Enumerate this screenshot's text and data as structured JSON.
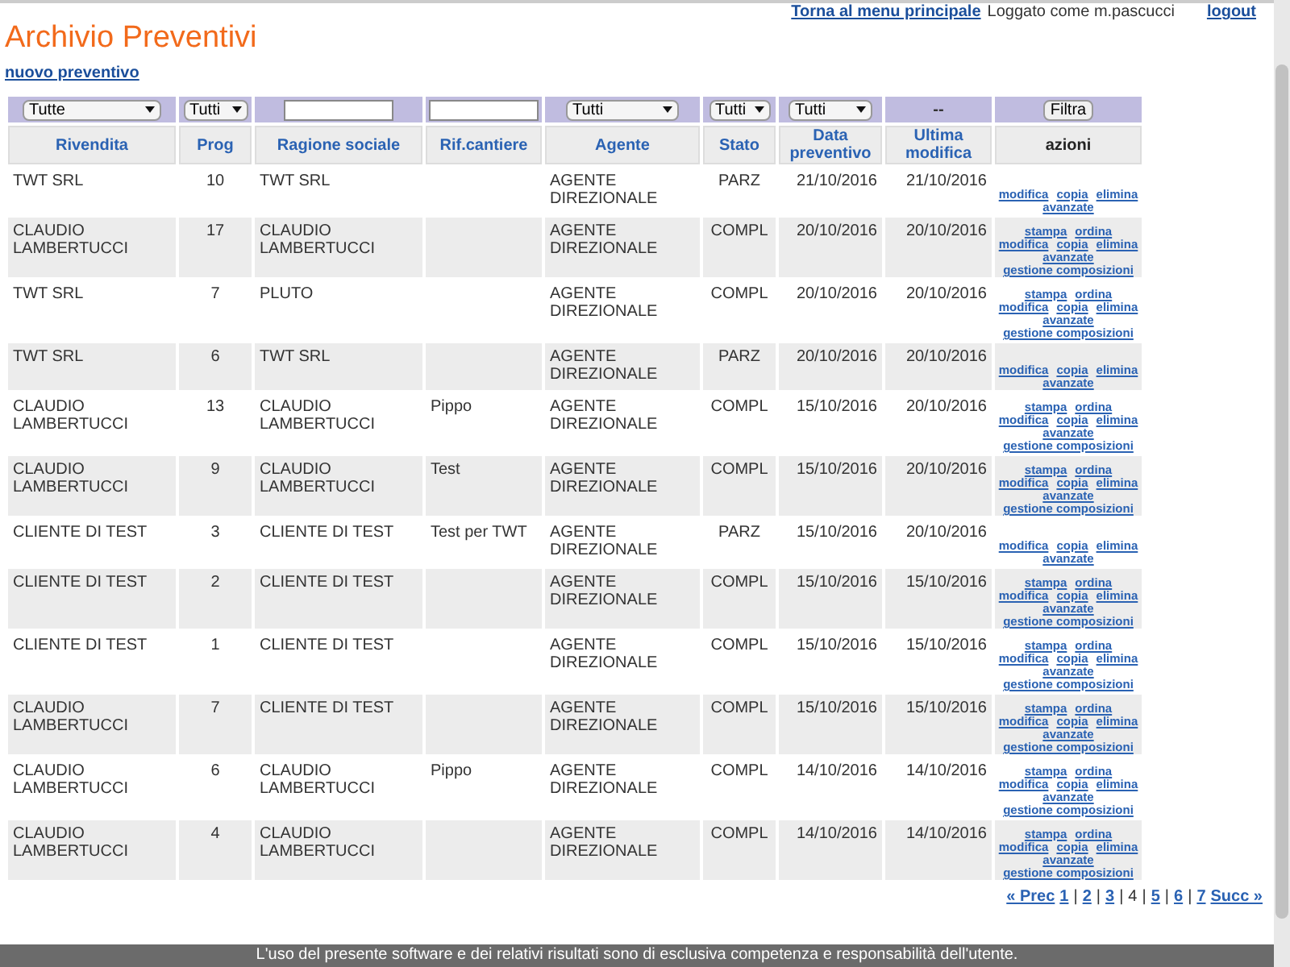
{
  "top_bar": {
    "menu_link": "Torna al menu principale",
    "user_text": "Loggato come m.pascucci",
    "logout_link": "logout"
  },
  "title": "Archivio Preventivi",
  "new_link": "nuovo preventivo",
  "filters": [
    {
      "kind": "select",
      "value": "Tutte"
    },
    {
      "kind": "select",
      "value": "Tutti"
    },
    {
      "kind": "input"
    },
    {
      "kind": "input"
    },
    {
      "kind": "select",
      "value": "Tutti"
    },
    {
      "kind": "select",
      "value": "Tutti"
    },
    {
      "kind": "select",
      "value": "Tutti"
    },
    {
      "kind": "text",
      "value": "--"
    },
    {
      "kind": "button",
      "value": "Filtra"
    }
  ],
  "table": {
    "columns": [
      "Rivendita",
      "Prog",
      "Ragione sociale",
      "Rif.cantiere",
      "Agente",
      "Stato",
      "Data preventivo",
      "Ultima modifica",
      "azioni"
    ],
    "rows": [
      {
        "cells": [
          "TWT SRL",
          "10",
          "TWT SRL",
          "",
          "AGENTE DIREZIONALE",
          "PARZ",
          "21/10/2016",
          "21/10/2016"
        ],
        "actions": [
          [
            "modifica",
            "copia",
            "elimina"
          ],
          [
            "avanzate"
          ]
        ]
      },
      {
        "cells": [
          "CLAUDIO LAMBERTUCCI",
          "17",
          "CLAUDIO LAMBERTUCCI",
          "",
          "AGENTE DIREZIONALE",
          "COMPL",
          "20/10/2016",
          "20/10/2016"
        ],
        "actions": [
          [
            "stampa",
            "ordina"
          ],
          [
            "modifica",
            "copia",
            "elimina"
          ],
          [
            "avanzate"
          ],
          [
            "gestione composizioni"
          ]
        ]
      },
      {
        "cells": [
          "TWT SRL",
          "7",
          "PLUTO",
          "",
          "AGENTE DIREZIONALE",
          "COMPL",
          "20/10/2016",
          "20/10/2016"
        ],
        "actions": [
          [
            "stampa",
            "ordina"
          ],
          [
            "modifica",
            "copia",
            "elimina"
          ],
          [
            "avanzate"
          ],
          [
            "gestione composizioni"
          ]
        ]
      },
      {
        "cells": [
          "TWT SRL",
          "6",
          "TWT SRL",
          "",
          "AGENTE DIREZIONALE",
          "PARZ",
          "20/10/2016",
          "20/10/2016"
        ],
        "actions": [
          [
            "modifica",
            "copia",
            "elimina"
          ],
          [
            "avanzate"
          ]
        ]
      },
      {
        "cells": [
          "CLAUDIO LAMBERTUCCI",
          "13",
          "CLAUDIO LAMBERTUCCI",
          "Pippo",
          "AGENTE DIREZIONALE",
          "COMPL",
          "15/10/2016",
          "20/10/2016"
        ],
        "actions": [
          [
            "stampa",
            "ordina"
          ],
          [
            "modifica",
            "copia",
            "elimina"
          ],
          [
            "avanzate"
          ],
          [
            "gestione composizioni"
          ]
        ]
      },
      {
        "cells": [
          "CLAUDIO LAMBERTUCCI",
          "9",
          "CLAUDIO LAMBERTUCCI",
          "Test",
          "AGENTE DIREZIONALE",
          "COMPL",
          "15/10/2016",
          "20/10/2016"
        ],
        "actions": [
          [
            "stampa",
            "ordina"
          ],
          [
            "modifica",
            "copia",
            "elimina"
          ],
          [
            "avanzate"
          ],
          [
            "gestione composizioni"
          ]
        ]
      },
      {
        "cells": [
          "CLIENTE DI TEST",
          "3",
          "CLIENTE DI TEST",
          "Test per TWT",
          "AGENTE DIREZIONALE",
          "PARZ",
          "15/10/2016",
          "20/10/2016"
        ],
        "actions": [
          [
            "modifica",
            "copia",
            "elimina"
          ],
          [
            "avanzate"
          ]
        ]
      },
      {
        "cells": [
          "CLIENTE DI TEST",
          "2",
          "CLIENTE DI TEST",
          "",
          "AGENTE DIREZIONALE",
          "COMPL",
          "15/10/2016",
          "15/10/2016"
        ],
        "actions": [
          [
            "stampa",
            "ordina"
          ],
          [
            "modifica",
            "copia",
            "elimina"
          ],
          [
            "avanzate"
          ],
          [
            "gestione composizioni"
          ]
        ]
      },
      {
        "cells": [
          "CLIENTE DI TEST",
          "1",
          "CLIENTE DI TEST",
          "",
          "AGENTE DIREZIONALE",
          "COMPL",
          "15/10/2016",
          "15/10/2016"
        ],
        "actions": [
          [
            "stampa",
            "ordina"
          ],
          [
            "modifica",
            "copia",
            "elimina"
          ],
          [
            "avanzate"
          ],
          [
            "gestione composizioni"
          ]
        ]
      },
      {
        "cells": [
          "CLAUDIO LAMBERTUCCI",
          "7",
          "CLIENTE DI TEST",
          "",
          "AGENTE DIREZIONALE",
          "COMPL",
          "15/10/2016",
          "15/10/2016"
        ],
        "actions": [
          [
            "stampa",
            "ordina"
          ],
          [
            "modifica",
            "copia",
            "elimina"
          ],
          [
            "avanzate"
          ],
          [
            "gestione composizioni"
          ]
        ]
      },
      {
        "cells": [
          "CLAUDIO LAMBERTUCCI",
          "6",
          "CLAUDIO LAMBERTUCCI",
          "Pippo",
          "AGENTE DIREZIONALE",
          "COMPL",
          "14/10/2016",
          "14/10/2016"
        ],
        "actions": [
          [
            "stampa",
            "ordina"
          ],
          [
            "modifica",
            "copia",
            "elimina"
          ],
          [
            "avanzate"
          ],
          [
            "gestione composizioni"
          ]
        ]
      },
      {
        "cells": [
          "CLAUDIO LAMBERTUCCI",
          "4",
          "CLAUDIO LAMBERTUCCI",
          "",
          "AGENTE DIREZIONALE",
          "COMPL",
          "14/10/2016",
          "14/10/2016"
        ],
        "actions": [
          [
            "stampa",
            "ordina"
          ],
          [
            "modifica",
            "copia",
            "elimina"
          ],
          [
            "avanzate"
          ],
          [
            "gestione composizioni"
          ]
        ]
      }
    ]
  },
  "pagination": {
    "separator": "|",
    "pages": [
      {
        "label": "« Prec",
        "selected": false
      },
      {
        "label": "1",
        "selected": false
      },
      {
        "label": "2",
        "selected": false
      },
      {
        "label": "3",
        "selected": false
      },
      {
        "label": "4",
        "selected": true
      },
      {
        "label": "5",
        "selected": false
      },
      {
        "label": "6",
        "selected": false
      },
      {
        "label": "7",
        "selected": false
      },
      {
        "label": "Succ »",
        "selected": false
      }
    ]
  },
  "footer": "L'uso del presente software e dei relativi risultati sono di esclusiva competenza e responsabilità dell'utente."
}
